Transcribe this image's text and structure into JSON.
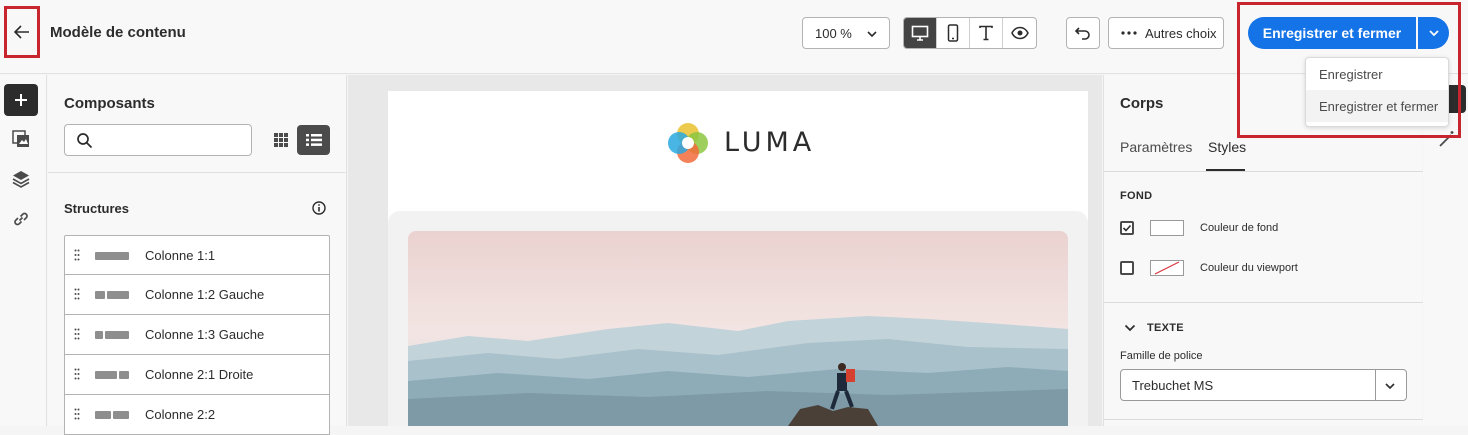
{
  "header": {
    "title": "Modèle de contenu",
    "zoom": "100 %",
    "more_label": "Autres choix",
    "save_close_label": "Enregistrer et fermer",
    "dropdown": [
      "Enregistrer",
      "Enregistrer et fermer"
    ]
  },
  "components": {
    "title": "Composants",
    "search_placeholder": "",
    "structures_title": "Structures",
    "structures": [
      {
        "label": "Colonne 1:1"
      },
      {
        "label": "Colonne 1:2 Gauche"
      },
      {
        "label": "Colonne 1:3 Gauche"
      },
      {
        "label": "Colonne 2:1 Droite"
      },
      {
        "label": "Colonne 2:2"
      }
    ]
  },
  "canvas": {
    "logo_text": "LUMA"
  },
  "props": {
    "title": "Corps",
    "tabs": [
      "Paramètres",
      "Styles"
    ],
    "active_tab": "Styles",
    "fond_label": "FOND",
    "bg_color_label": "Couleur de fond",
    "viewport_color_label": "Couleur du viewport",
    "texte_label": "TEXTE",
    "font_family_label": "Famille de police",
    "font_family_value": "Trebuchet MS"
  },
  "colors": {
    "accent": "#1473e6",
    "highlight": "#c8262f"
  },
  "icons": [
    "arrow-left-icon",
    "chevron-down-icon",
    "desktop-icon",
    "mobile-icon",
    "text-icon",
    "eye-icon",
    "undo-icon",
    "more-icon",
    "plus-icon",
    "assets-icon",
    "layers-icon",
    "link-icon",
    "search-icon",
    "grid-view-icon",
    "list-view-icon",
    "info-icon",
    "drag-handle-icon",
    "checkbox-icon"
  ]
}
